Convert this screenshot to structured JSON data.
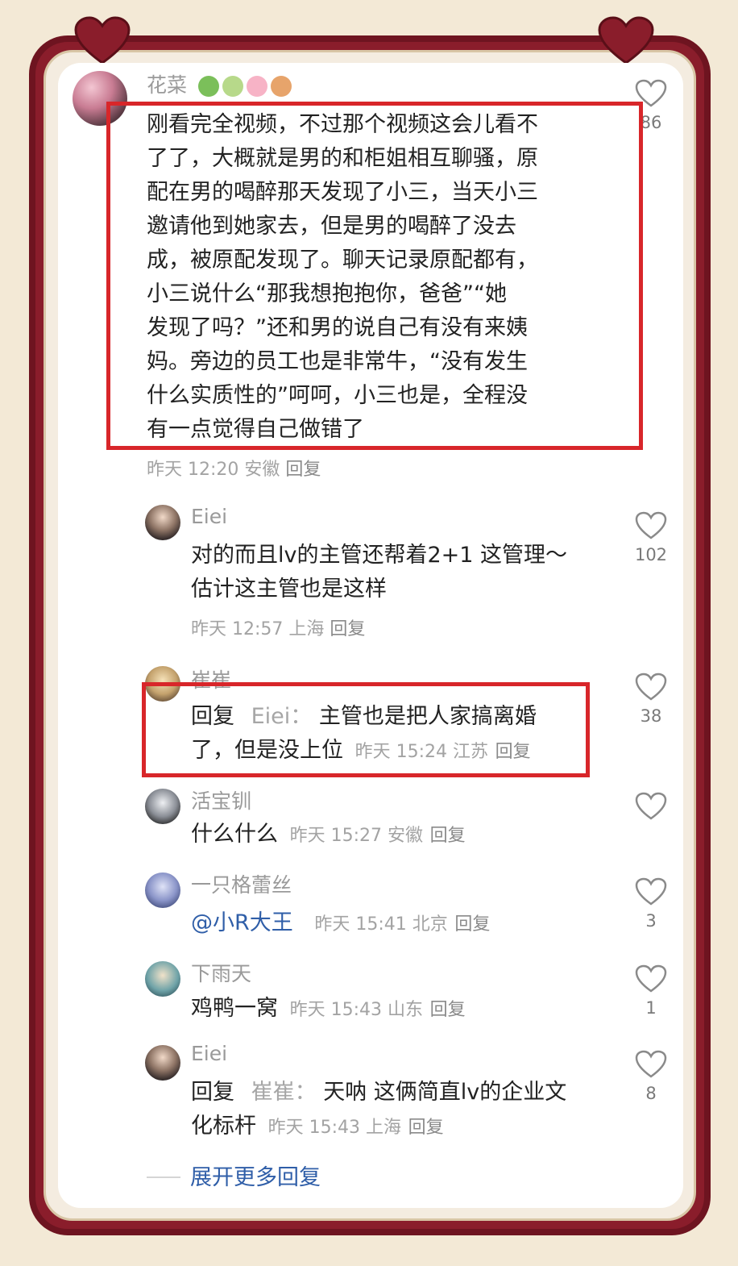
{
  "colors": {
    "frame": "#8a1d2b",
    "background": "#f3e9d6",
    "card": "#ffffff",
    "highlight": "#d8262a",
    "link": "#2f5ea8"
  },
  "decorations": {
    "icons": [
      "heart-icon",
      "heart-icon"
    ]
  },
  "main_comment": {
    "username": "花菜",
    "emoji": [
      "broccoli-emoji",
      "leaf-emoji",
      "cherry-blossom-emoji",
      "autumn-leaf-emoji"
    ],
    "lines": [
      "刚看完全视频，不过那个视频这会儿看不",
      "了了，大概就是男的和柜姐相互聊骚，原",
      "配在男的喝醉那天发现了小三，当天小三",
      "邀请他到她家去，但是男的喝醉了没去",
      "成，被原配发现了。聊天记录原配都有，",
      "小三说什么“那我想抱抱你，爸爸”“她",
      "发现了吗？”还和男的说自己有没有来姨",
      "妈。旁边的员工也是非常牛，“没有发生",
      "什么实质性的”呵呵，小三也是，全程没",
      "有一点觉得自己做错了"
    ],
    "meta": "昨天 12:20 安徽",
    "reply": "回复",
    "likes": "86"
  },
  "replies": [
    {
      "username": "Eiei",
      "lines": [
        "对的而且lv的主管还帮着2+1 这管理～",
        "估计这主管也是这样"
      ],
      "meta": "昨天 12:57 上海",
      "reply": "回复",
      "likes": "102"
    },
    {
      "username": "崔崔",
      "prefix": "回复",
      "quoted": "Eiei：",
      "line1": "主管也是把人家搞离婚",
      "line2": "了，但是没上位",
      "meta": "昨天 15:24 江苏",
      "reply": "回复",
      "likes": "38"
    },
    {
      "username": "活宝钏",
      "body": "什么什么",
      "meta": "昨天 15:27 安徽",
      "reply": "回复",
      "likes": ""
    },
    {
      "username": "一只格蕾丝",
      "mention": "@小R大王",
      "meta": "昨天 15:41 北京",
      "reply": "回复",
      "likes": "3"
    },
    {
      "username": "下雨天",
      "body": "鸡鸭一窝",
      "meta": "昨天 15:43 山东",
      "reply": "回复",
      "likes": "1"
    },
    {
      "username": "Eiei",
      "prefix": "回复",
      "quoted": "崔崔：",
      "line1": "天呐 这俩简直lv的企业文",
      "line2": "化标杆",
      "meta": "昨天 15:43 上海",
      "reply": "回复",
      "likes": "8"
    }
  ],
  "expand_label": "展开更多回复"
}
